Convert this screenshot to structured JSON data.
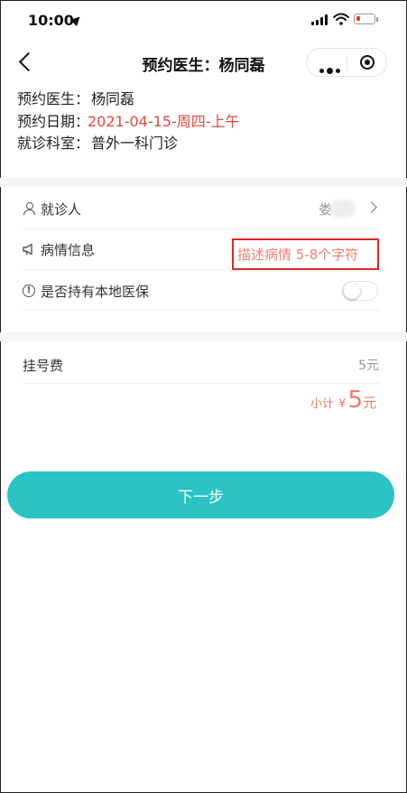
{
  "status_bar": {
    "time": "10:00"
  },
  "nav": {
    "title": "预约医生：杨同磊"
  },
  "info": {
    "doctor_label": "预约医生：",
    "doctor_value": "杨同磊",
    "date_label": "预约日期：",
    "date_value": "2021-04-15-周四-上午",
    "dept_label": "就诊科室：",
    "dept_value": "普外一科门诊"
  },
  "form": {
    "patient_label": "就诊人",
    "patient_value": "娄",
    "condition_label": "病情信息",
    "condition_placeholder": "描述病情 5-8个字符",
    "insurance_label": "是否持有本地医保",
    "insurance_enabled": false
  },
  "fee": {
    "label": "挂号费",
    "value": "5元",
    "subtotal_label": "小计",
    "subtotal_currency": "¥",
    "subtotal_amount": "5",
    "subtotal_unit": "元"
  },
  "actions": {
    "next_label": "下一步"
  },
  "colors": {
    "accent": "#2cc3c5",
    "highlight": "#e14a3b",
    "box": "#e0262a"
  }
}
